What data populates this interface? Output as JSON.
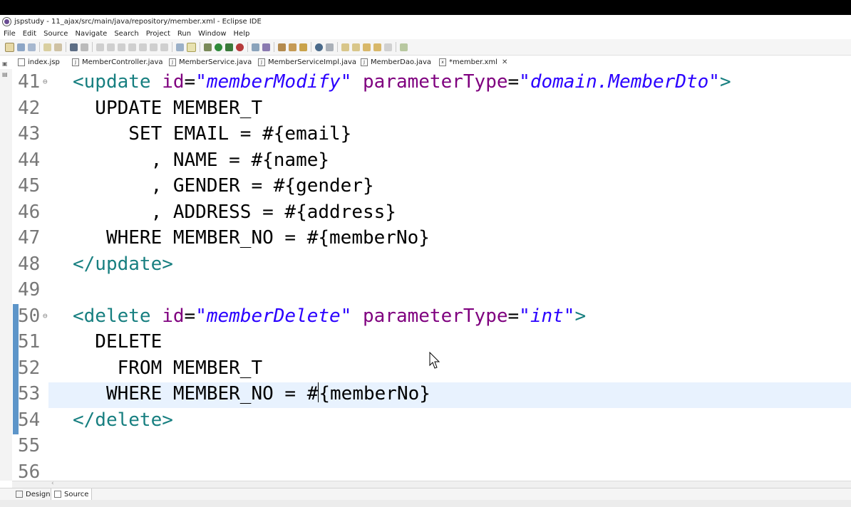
{
  "window": {
    "title": "jspstudy - 11_ajax/src/main/java/repository/member.xml - Eclipse IDE"
  },
  "menu": [
    "File",
    "Edit",
    "Source",
    "Navigate",
    "Search",
    "Project",
    "Run",
    "Window",
    "Help"
  ],
  "tabs": [
    {
      "label": "index.jsp",
      "active": false
    },
    {
      "label": "MemberController.java",
      "active": false
    },
    {
      "label": "MemberService.java",
      "active": false
    },
    {
      "label": "MemberServiceImpl.java",
      "active": false
    },
    {
      "label": "MemberDao.java",
      "active": false
    },
    {
      "label": "*member.xml",
      "active": true
    }
  ],
  "editor": {
    "lines": [
      {
        "num": "41",
        "fold": true,
        "segments": [
          {
            "t": "tag",
            "v": "<update "
          },
          {
            "t": "attr",
            "v": "id"
          },
          {
            "t": "eq",
            "v": "="
          },
          {
            "t": "str",
            "v": "\"memberModify\""
          },
          {
            "t": "eq",
            "v": " "
          },
          {
            "t": "attr",
            "v": "parameterType"
          },
          {
            "t": "eq",
            "v": "="
          },
          {
            "t": "str",
            "v": "\"domain.MemberDto\""
          },
          {
            "t": "tag",
            "v": ">"
          }
        ]
      },
      {
        "num": "42",
        "segments": [
          {
            "t": "sql",
            "v": "  UPDATE MEMBER_T"
          }
        ]
      },
      {
        "num": "43",
        "segments": [
          {
            "t": "sql",
            "v": "     SET EMAIL = #{email}"
          }
        ]
      },
      {
        "num": "44",
        "segments": [
          {
            "t": "sql",
            "v": "       , NAME = #{name}"
          }
        ]
      },
      {
        "num": "45",
        "segments": [
          {
            "t": "sql",
            "v": "       , GENDER = #{gender}"
          }
        ]
      },
      {
        "num": "46",
        "segments": [
          {
            "t": "sql",
            "v": "       , ADDRESS = #{address}"
          }
        ]
      },
      {
        "num": "47",
        "segments": [
          {
            "t": "sql",
            "v": "   WHERE MEMBER_NO = #{memberNo}"
          }
        ]
      },
      {
        "num": "48",
        "segments": [
          {
            "t": "tag",
            "v": "</update>"
          }
        ]
      },
      {
        "num": "49",
        "segments": []
      },
      {
        "num": "50",
        "fold": true,
        "segments": [
          {
            "t": "tag",
            "v": "<delete "
          },
          {
            "t": "attr",
            "v": "id"
          },
          {
            "t": "eq",
            "v": "="
          },
          {
            "t": "str",
            "v": "\"memberDelete\""
          },
          {
            "t": "eq",
            "v": " "
          },
          {
            "t": "attr",
            "v": "parameterType"
          },
          {
            "t": "eq",
            "v": "="
          },
          {
            "t": "str",
            "v": "\"int\""
          },
          {
            "t": "tag",
            "v": ">"
          }
        ]
      },
      {
        "num": "51",
        "segments": [
          {
            "t": "sql",
            "v": "  DELETE"
          }
        ]
      },
      {
        "num": "52",
        "segments": [
          {
            "t": "sql",
            "v": "    FROM MEMBER_T"
          }
        ]
      },
      {
        "num": "53",
        "current": true,
        "segments": [
          {
            "t": "sql",
            "v": "   WHERE MEMBER_NO = #"
          },
          {
            "t": "caret",
            "v": ""
          },
          {
            "t": "sql",
            "v": "{memberNo}"
          }
        ]
      },
      {
        "num": "54",
        "segments": [
          {
            "t": "tag",
            "v": "</delete>"
          }
        ]
      },
      {
        "num": "55",
        "segments": []
      },
      {
        "num": "56",
        "segments": []
      }
    ]
  },
  "bottom_tabs": [
    {
      "label": "Design",
      "active": false
    },
    {
      "label": "Source",
      "active": true
    }
  ]
}
